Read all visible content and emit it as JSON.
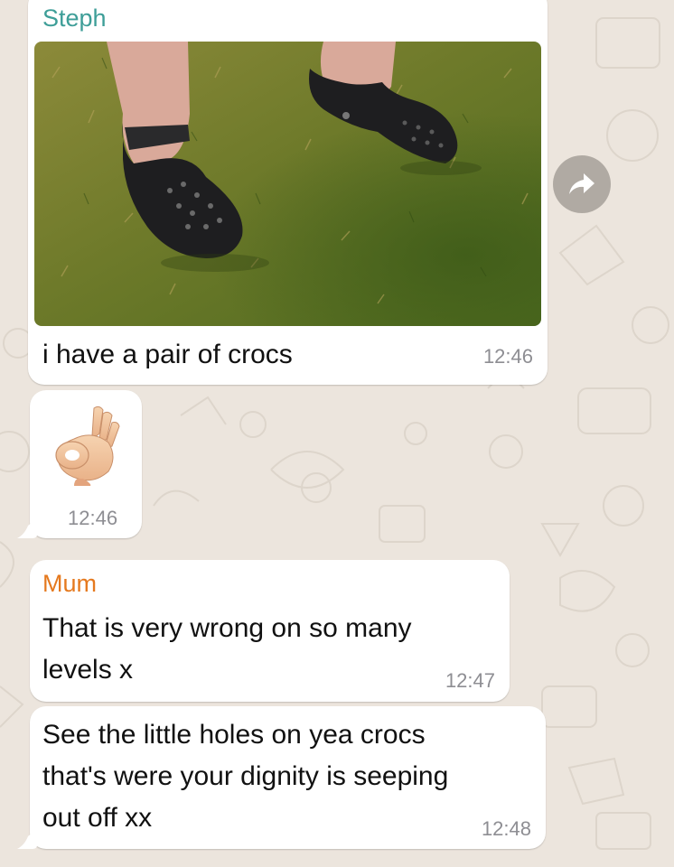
{
  "colors": {
    "chat_background": "#ECE5DD",
    "bubble": "#FFFFFF",
    "sender_steph": "#3E9E98",
    "sender_mum": "#E5791E",
    "timestamp": "#8E8E93"
  },
  "messages": [
    {
      "sender": "Steph",
      "type": "image",
      "image_icon": "photo-crocs-on-grass",
      "text": "i have a pair of crocs",
      "time": "12:46"
    },
    {
      "type": "emoji",
      "emoji": "👌",
      "emoji_icon": "ok-hand-emoji",
      "time": "12:46"
    },
    {
      "sender": "Mum",
      "type": "text",
      "text": "That is very wrong on so many\nlevels x",
      "time": "12:47"
    },
    {
      "type": "text",
      "text": "See the little holes on yea crocs\nthat's were your dignity is seeping\nout off xx",
      "time": "12:48"
    }
  ],
  "forward_button": {
    "icon": "forward-arrow-icon"
  }
}
